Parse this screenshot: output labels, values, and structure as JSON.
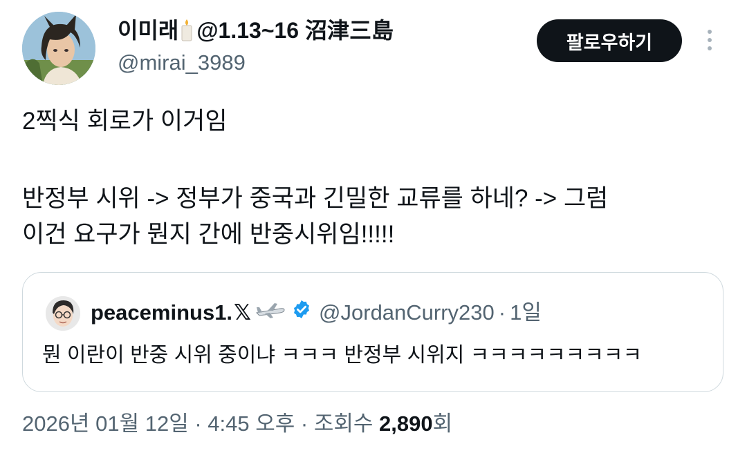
{
  "author": {
    "display_name_prefix": "이미래",
    "display_name_suffix": "@1.13~16 沼津三島",
    "handle": "@mirai_3989"
  },
  "follow_button_label": "팔로우하기",
  "tweet": {
    "line1": "2찍식 회로가 이거임",
    "line2": "반정부 시위 -> 정부가 중국과 긴밀한 교류를 하네? -> 그럼",
    "line3": "이건 요구가 뭔지 간에 반중시위임!!!!!"
  },
  "quote": {
    "display_name": "peaceminus1.",
    "x_mark": "𝕏",
    "handle": "@JordanCurry230",
    "separator": "·",
    "time": "1일",
    "text": "뭔 이란이 반중 시위 중이냐 ㅋㅋㅋ 반정부 시위지 ㅋㅋㅋㅋㅋㅋㅋㅋㅋ"
  },
  "meta": {
    "date": "2026년 01월 12일",
    "sep1": " · ",
    "time": "4:45 오후",
    "sep2": " · ",
    "views_label": "조회수 ",
    "views_count": "2,890",
    "views_suffix": "회"
  },
  "colors": {
    "text_primary": "#0f1419",
    "text_secondary": "#536471",
    "border": "#cfd9de",
    "verified": "#1d9bf0"
  },
  "icons": {
    "candle": "candle-icon",
    "plane": "airplane-icon",
    "verified": "verified-badge-icon",
    "more": "more-vertical-icon"
  }
}
